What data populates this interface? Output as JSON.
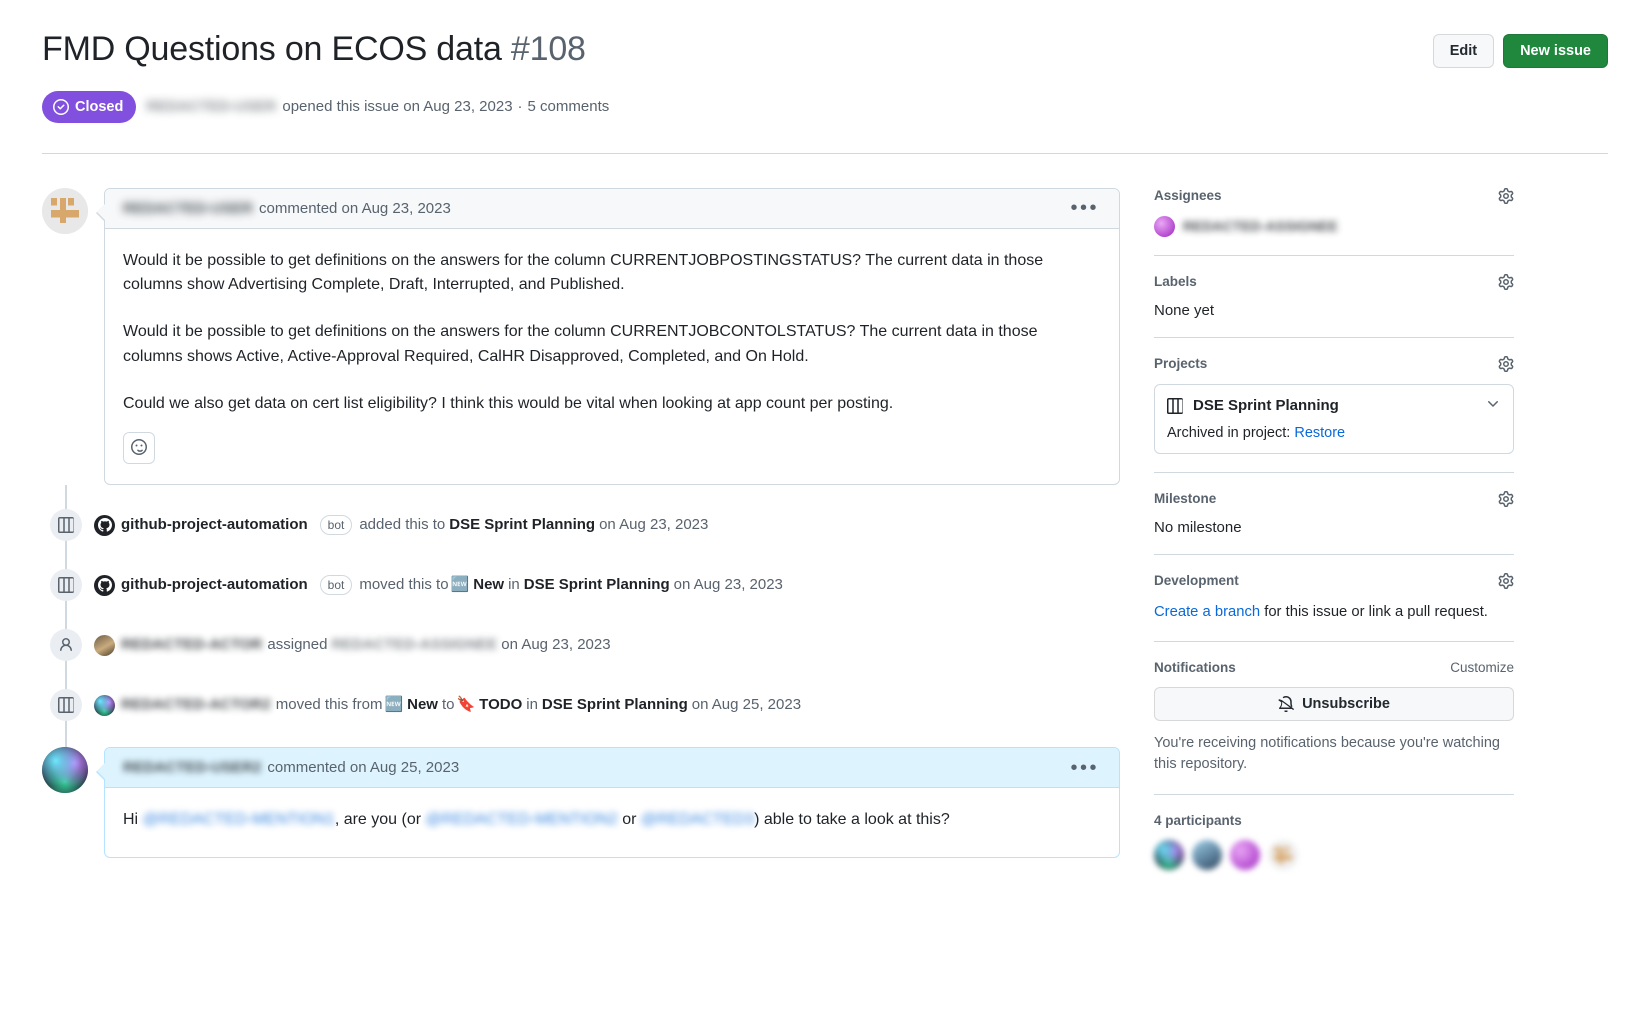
{
  "header": {
    "title": "FMD Questions on ECOS data",
    "issue_number": "#108",
    "edit_label": "Edit",
    "new_issue_label": "New issue",
    "state": "Closed",
    "state_color": "#8250df",
    "author": "REDACTED-USER",
    "opened_text": "opened this issue on Aug 23, 2023",
    "separator": "·",
    "comment_count": "5 comments"
  },
  "comments": [
    {
      "author": "REDACTED-USER",
      "action": "commented on Aug 23, 2023",
      "paragraphs": [
        "Would it be possible to get definitions on the answers for the column CURRENTJOBPOSTINGSTATUS? The current data in those columns show Advertising Complete, Draft, Interrupted, and Published.",
        "Would it be possible to get definitions on the answers for the column CURRENTJOBCONTOLSTATUS? The current data in those columns shows Active, Active-Approval Required, CalHR Disapproved, Completed, and On Hold.",
        "Could we also get data on cert list eligibility? I think this would be vital when looking at app count per posting."
      ]
    }
  ],
  "events": [
    {
      "icon": "project-board-icon",
      "actor": "github-project-automation",
      "bot_tag": "bot",
      "verb": "added this to",
      "target": "DSE Sprint Planning",
      "date": "on Aug 23, 2023"
    },
    {
      "icon": "project-board-icon",
      "actor": "github-project-automation",
      "bot_tag": "bot",
      "verb": "moved this to",
      "emoji_to": "🆕",
      "column_to": "New",
      "in_word": "in",
      "target": "DSE Sprint Planning",
      "date": "on Aug 23, 2023"
    },
    {
      "icon": "person-icon",
      "actor": "REDACTED-ACTOR",
      "verb": "assigned",
      "assignee": "REDACTED-ASSIGNEE",
      "date": "on Aug 23, 2023"
    },
    {
      "icon": "project-board-icon",
      "actor": "REDACTED-ACTOR2",
      "verb": "moved this from",
      "emoji_from": "🆕",
      "column_from": "New",
      "to_word": "to",
      "emoji_to": "🔖",
      "column_to": "TODO",
      "in_word": "in",
      "target": "DSE Sprint Planning",
      "date": "on Aug 25, 2023"
    }
  ],
  "bottom_comment": {
    "author": "REDACTED-USER2",
    "action": "commented on Aug 25, 2023",
    "text_start": "Hi",
    "mention1": "@REDACTED-MENTION1",
    "text_mid1": ", are you (or",
    "mention2": "@REDACTED-MENTION2",
    "text_mid2": "or",
    "mention3": "@REDACTED3",
    "text_end": ") able to take a look at this?"
  },
  "sidebar": {
    "assignees": {
      "title": "Assignees",
      "value": "REDACTED-ASSIGNEE"
    },
    "labels": {
      "title": "Labels",
      "value": "None yet"
    },
    "projects": {
      "title": "Projects",
      "project_name": "DSE Sprint Planning",
      "archived_text": "Archived in project:",
      "restore_link": "Restore"
    },
    "milestone": {
      "title": "Milestone",
      "value": "No milestone"
    },
    "development": {
      "title": "Development",
      "link": "Create a branch",
      "rest": " for this issue or link a pull request."
    },
    "notifications": {
      "title": "Notifications",
      "customize": "Customize",
      "button_label": "Unsubscribe",
      "note": "You're receiving notifications because you're watching this repository."
    },
    "participants": {
      "title": "4 participants"
    }
  }
}
